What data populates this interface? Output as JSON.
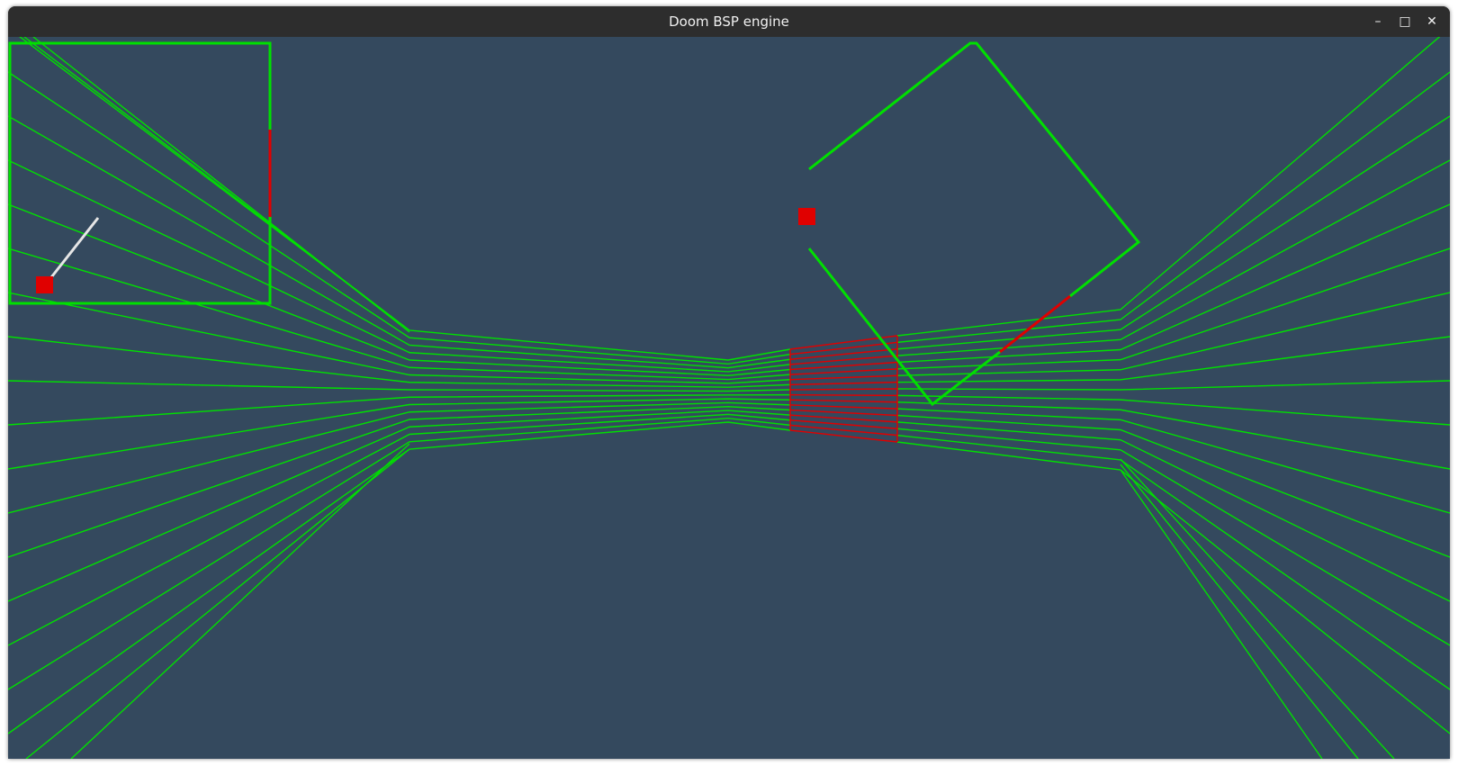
{
  "window": {
    "title": "Doom BSP engine",
    "minimize_glyph": "–",
    "maximize_glyph": "□",
    "close_glyph": "✕"
  },
  "colors": {
    "background": "#34495e",
    "titlebar": "#2d2d2d",
    "wall": "#00e000",
    "wall_hidden": "#e00000",
    "player": "#e00000",
    "view_ray": "#e0e0e0"
  }
}
